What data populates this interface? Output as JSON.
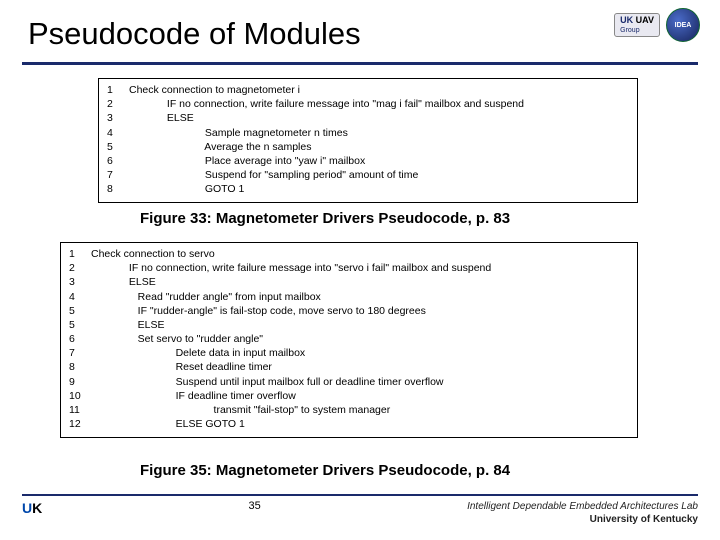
{
  "title": "Pseudocode of Modules",
  "logos": {
    "l1_top": "UK",
    "l1_mid": "UAV",
    "l1_sub": "Group",
    "l2": "IDEA"
  },
  "box1": {
    "lines": [
      {
        "n": "1",
        "t": "Check connection to magnetometer i"
      },
      {
        "n": "2",
        "t": "             IF no connection, write failure message into \"mag i fail\" mailbox and suspend"
      },
      {
        "n": "3",
        "t": "             ELSE"
      },
      {
        "n": "4",
        "t": "                          Sample magnetometer n times"
      },
      {
        "n": "5",
        "t": "                          Average the n samples"
      },
      {
        "n": "6",
        "t": "                          Place average into \"yaw i\" mailbox"
      },
      {
        "n": "7",
        "t": "                          Suspend for \"sampling period\" amount of time"
      },
      {
        "n": "8",
        "t": "                          GOTO 1"
      }
    ]
  },
  "caption1": "Figure 33: Magnetometer Drivers Pseudocode, p. 83",
  "box2": {
    "lines": [
      {
        "n": "1",
        "t": "Check connection to servo"
      },
      {
        "n": "2",
        "t": "             IF no connection, write failure message into \"servo i fail\" mailbox and suspend"
      },
      {
        "n": "3",
        "t": "             ELSE"
      },
      {
        "n": "4",
        "t": "                Read \"rudder angle\" from input mailbox"
      },
      {
        "n": "5",
        "t": "                IF \"rudder-angle\" is fail-stop code, move servo to 180 degrees"
      },
      {
        "n": "5",
        "t": "                ELSE"
      },
      {
        "n": "6",
        "t": "                Set servo to \"rudder angle\""
      },
      {
        "n": "7",
        "t": "                             Delete data in input mailbox"
      },
      {
        "n": "8",
        "t": "                             Reset deadline timer"
      },
      {
        "n": "9",
        "t": "                             Suspend until input mailbox full or deadline timer overflow"
      },
      {
        "n": "10",
        "t": "                             IF deadline timer overflow"
      },
      {
        "n": "11",
        "t": "                                          transmit \"fail-stop\" to system manager"
      },
      {
        "n": "12",
        "t": "                             ELSE GOTO 1"
      }
    ]
  },
  "caption2": "Figure 35: Magnetometer Drivers Pseudocode, p. 84",
  "footer": {
    "leftU": "U",
    "leftK": "K",
    "page": "35",
    "lab": "Intelligent Dependable Embedded Architectures Lab",
    "uni": "University of Kentucky"
  }
}
